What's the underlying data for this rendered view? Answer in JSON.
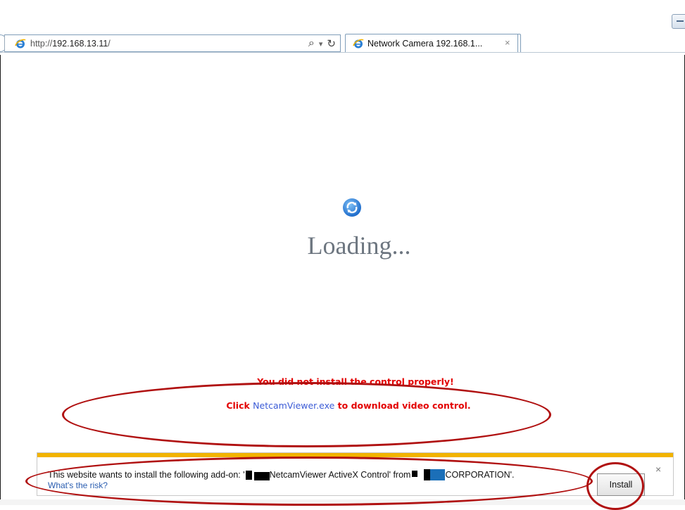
{
  "browser": {
    "url_prefix": "http://",
    "url_host": "192.168.13.11",
    "url_suffix": "/",
    "search_glyph": "⌕",
    "dropdown_glyph": "▾",
    "refresh_glyph": "↻",
    "tab_title": "Network Camera 192.168.1...",
    "tab_close": "×"
  },
  "page": {
    "loading_text": "Loading...",
    "error_line1": "You did not install the control properly!",
    "error_line2_prefix": "Click ",
    "error_link": "NetcamViewer.exe",
    "error_line2_suffix": "  to download video control."
  },
  "notification": {
    "message_start": "This website wants to install the following add-on: '",
    "control_name": " NetcamViewer ActiveX Control' from ",
    "publisher_suffix": "CORPORATION'.",
    "risk_link": "What's the risk?",
    "install_label": "Install",
    "close_glyph": "×"
  },
  "colors": {
    "error_red": "#e30000",
    "link_blue": "#3b5bd6",
    "notification_accent": "#f2b300",
    "annotation_red": "#b01010"
  },
  "icons": [
    "ie-logo-icon",
    "search-icon",
    "refresh-icon",
    "close-icon",
    "loading-spinner-icon"
  ]
}
